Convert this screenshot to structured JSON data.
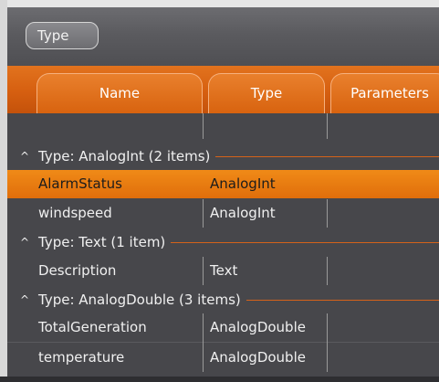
{
  "grouping": {
    "chip_label": "Type"
  },
  "columns": [
    {
      "label": "Name"
    },
    {
      "label": "Type"
    },
    {
      "label": "Parameters"
    }
  ],
  "groups": [
    {
      "header": "Type: AnalogInt (2 items)",
      "rows": [
        {
          "name": "AlarmStatus",
          "type": "AnalogInt",
          "selected": true
        },
        {
          "name": "windspeed",
          "type": "AnalogInt",
          "selected": false
        }
      ]
    },
    {
      "header": "Type: Text (1 item)",
      "rows": [
        {
          "name": "Description",
          "type": "Text",
          "selected": false
        }
      ]
    },
    {
      "header": "Type: AnalogDouble (3 items)",
      "rows": [
        {
          "name": "TotalGeneration",
          "type": "AnalogDouble",
          "selected": false
        },
        {
          "name": "temperature",
          "type": "AnalogDouble",
          "selected": false
        }
      ]
    }
  ],
  "colors": {
    "header_orange": "#d65f10",
    "selection_orange": "#f08a17",
    "grid_background": "#47474b"
  },
  "icons": {
    "group_toggle": "chevron-up-icon"
  }
}
